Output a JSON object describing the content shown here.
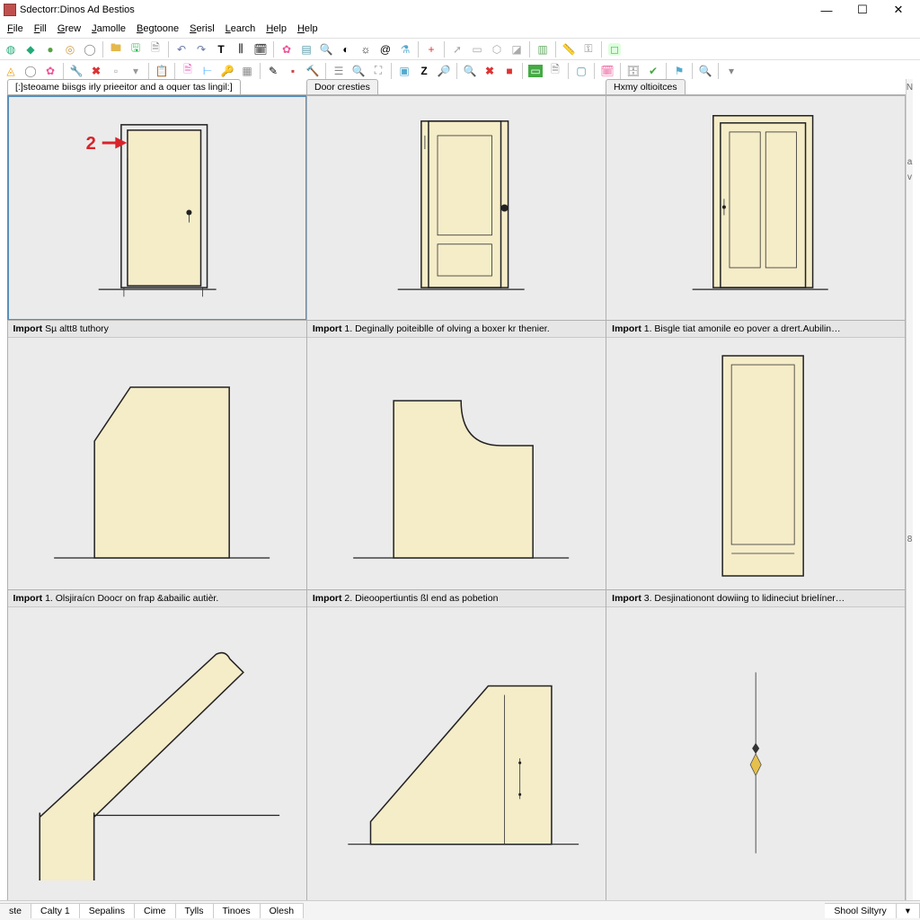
{
  "window": {
    "title": "Sdectorr:Dinos Ad Bestios"
  },
  "menu": [
    "File",
    "Fill",
    "Grew",
    "Jamolle",
    "Begtoone",
    "Serisl",
    "Learch",
    "Help",
    "Help"
  ],
  "tabs_top": {
    "left": "[:]steoame biisgs irly prieeitor and a oquer tas lingil:]",
    "middle": "Door cresties",
    "right": "Hxmy oltioitces"
  },
  "cells": {
    "r2c1": "Import Sµ altt8 tuthory",
    "r2c2": "Import 1.  Deginally poiteiblle of olving a boxer kr thenier.",
    "r2c3": "Import 1.  Bisgle tiat amonile eo pover a drert.Aubilin…",
    "r3c1": "Import 1.  Olsjiraícn Doocr on frap &abailic autièr.",
    "r3c2": "Import 2.  Dieoopertiuntis ßl end as pobetion",
    "r3c3": "Import 3.  Desjinationont dowiing to lidineciut brielíner…"
  },
  "annotation": {
    "num": "2"
  },
  "rightgutter": [
    "N",
    " ",
    "a",
    "v",
    " ",
    " ",
    "8"
  ],
  "status_tabs": [
    "ste",
    "Calty 1",
    "Sepalins",
    "Cime",
    "Tylls",
    "Tinoes",
    "Olesh"
  ],
  "status_right": "Shool Siltyry"
}
